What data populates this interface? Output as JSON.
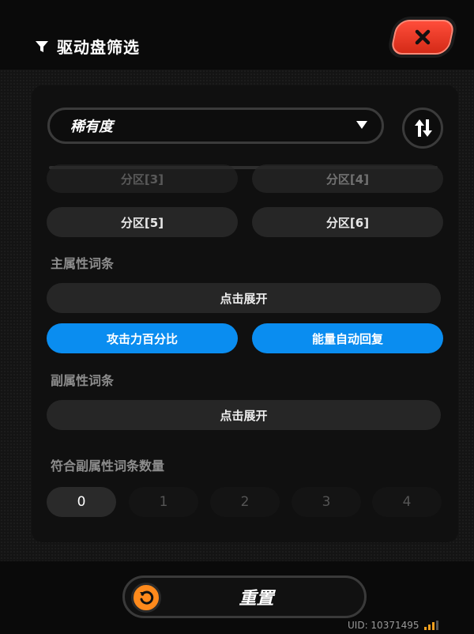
{
  "header": {
    "title": "驱动盘筛选",
    "close_icon": "close-icon"
  },
  "filter": {
    "sort_label": "稀有度"
  },
  "partitions": [
    {
      "label": "分区[3]"
    },
    {
      "label": "分区[4]"
    },
    {
      "label": "分区[5]"
    },
    {
      "label": "分区[6]"
    }
  ],
  "main_stat": {
    "label": "主属性词条",
    "expand_label": "点击展开",
    "options": [
      "攻击力百分比",
      "能量自动回复"
    ]
  },
  "sub_stat": {
    "label": "副属性词条",
    "expand_label": "点击展开"
  },
  "sub_count": {
    "label": "符合副属性词条数量",
    "options": [
      "0",
      "1",
      "2",
      "3",
      "4"
    ],
    "selected": "0"
  },
  "footer": {
    "reset_label": "重置",
    "uid": "UID: 10371495"
  },
  "colors": {
    "accent_blue": "#0a8df0",
    "close_red": "#e8341f",
    "reset_orange": "#ff8a1c"
  }
}
